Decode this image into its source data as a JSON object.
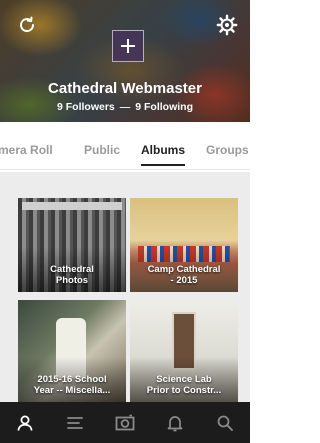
{
  "profile": {
    "name": "Cathedral Webmaster",
    "followers": "9 Followers",
    "separator": "—",
    "following": "9 Following"
  },
  "tabs": [
    {
      "label": "Camera Roll",
      "visible_label": "mera Roll"
    },
    {
      "label": "Public"
    },
    {
      "label": "Albums",
      "active": true
    },
    {
      "label": "Groups"
    }
  ],
  "albums": [
    {
      "title_line1": "Cathedral",
      "title_line2": "Photos"
    },
    {
      "title_line1": "Camp Cathedral",
      "title_line2": "- 2015"
    },
    {
      "title_line1": "2015-16 School",
      "title_line2": "Year -- Miscella..."
    },
    {
      "title_line1": "Science Lab",
      "title_line2": "Prior to Constr..."
    }
  ],
  "bottom_nav": [
    {
      "icon": "profile-icon",
      "active": true
    },
    {
      "icon": "feed-icon"
    },
    {
      "icon": "camera-icon"
    },
    {
      "icon": "notifications-icon"
    },
    {
      "icon": "search-icon"
    }
  ],
  "colors": {
    "bottom_bar": "#1c1c1c",
    "active_tab": "#222222",
    "inactive_tab": "#9a9a9a",
    "nav_active": "#ffffff",
    "nav_inactive": "#8a8a8a"
  }
}
